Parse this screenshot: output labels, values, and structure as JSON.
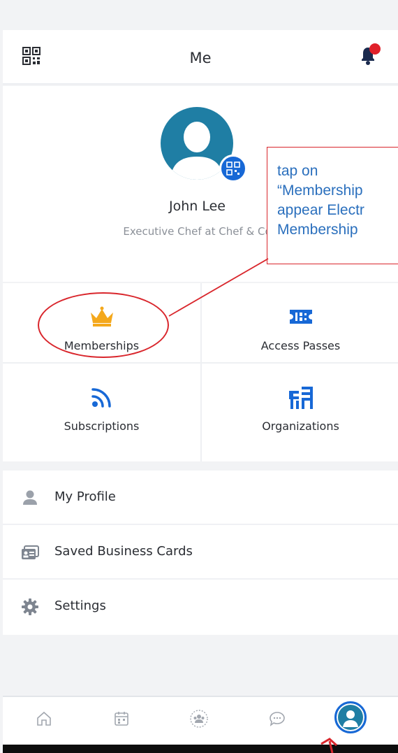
{
  "header": {
    "title": "Me"
  },
  "profile": {
    "name": "John Lee",
    "role": "Executive Chef at Chef & Co"
  },
  "grid": [
    {
      "label": "Memberships",
      "icon": "crown-icon"
    },
    {
      "label": "Access Passes",
      "icon": "ticket-icon"
    },
    {
      "label": "Subscriptions",
      "icon": "rss-icon"
    },
    {
      "label": "Organizations",
      "icon": "buildings-icon"
    }
  ],
  "menu": [
    {
      "label": "My Profile",
      "icon": "person-icon"
    },
    {
      "label": "Saved Business Cards",
      "icon": "id-card-icon"
    },
    {
      "label": "Settings",
      "icon": "gear-icon"
    }
  ],
  "nav": [
    "home-icon",
    "calendar-icon",
    "community-icon",
    "chat-icon",
    "profile-icon"
  ],
  "annotation": {
    "lines": [
      "tap on",
      "“Membership",
      "appear Electr",
      "Membership"
    ]
  },
  "colors": {
    "accent": "#1768d6",
    "crown": "#f4a81c",
    "annotation": "#d9262c"
  }
}
